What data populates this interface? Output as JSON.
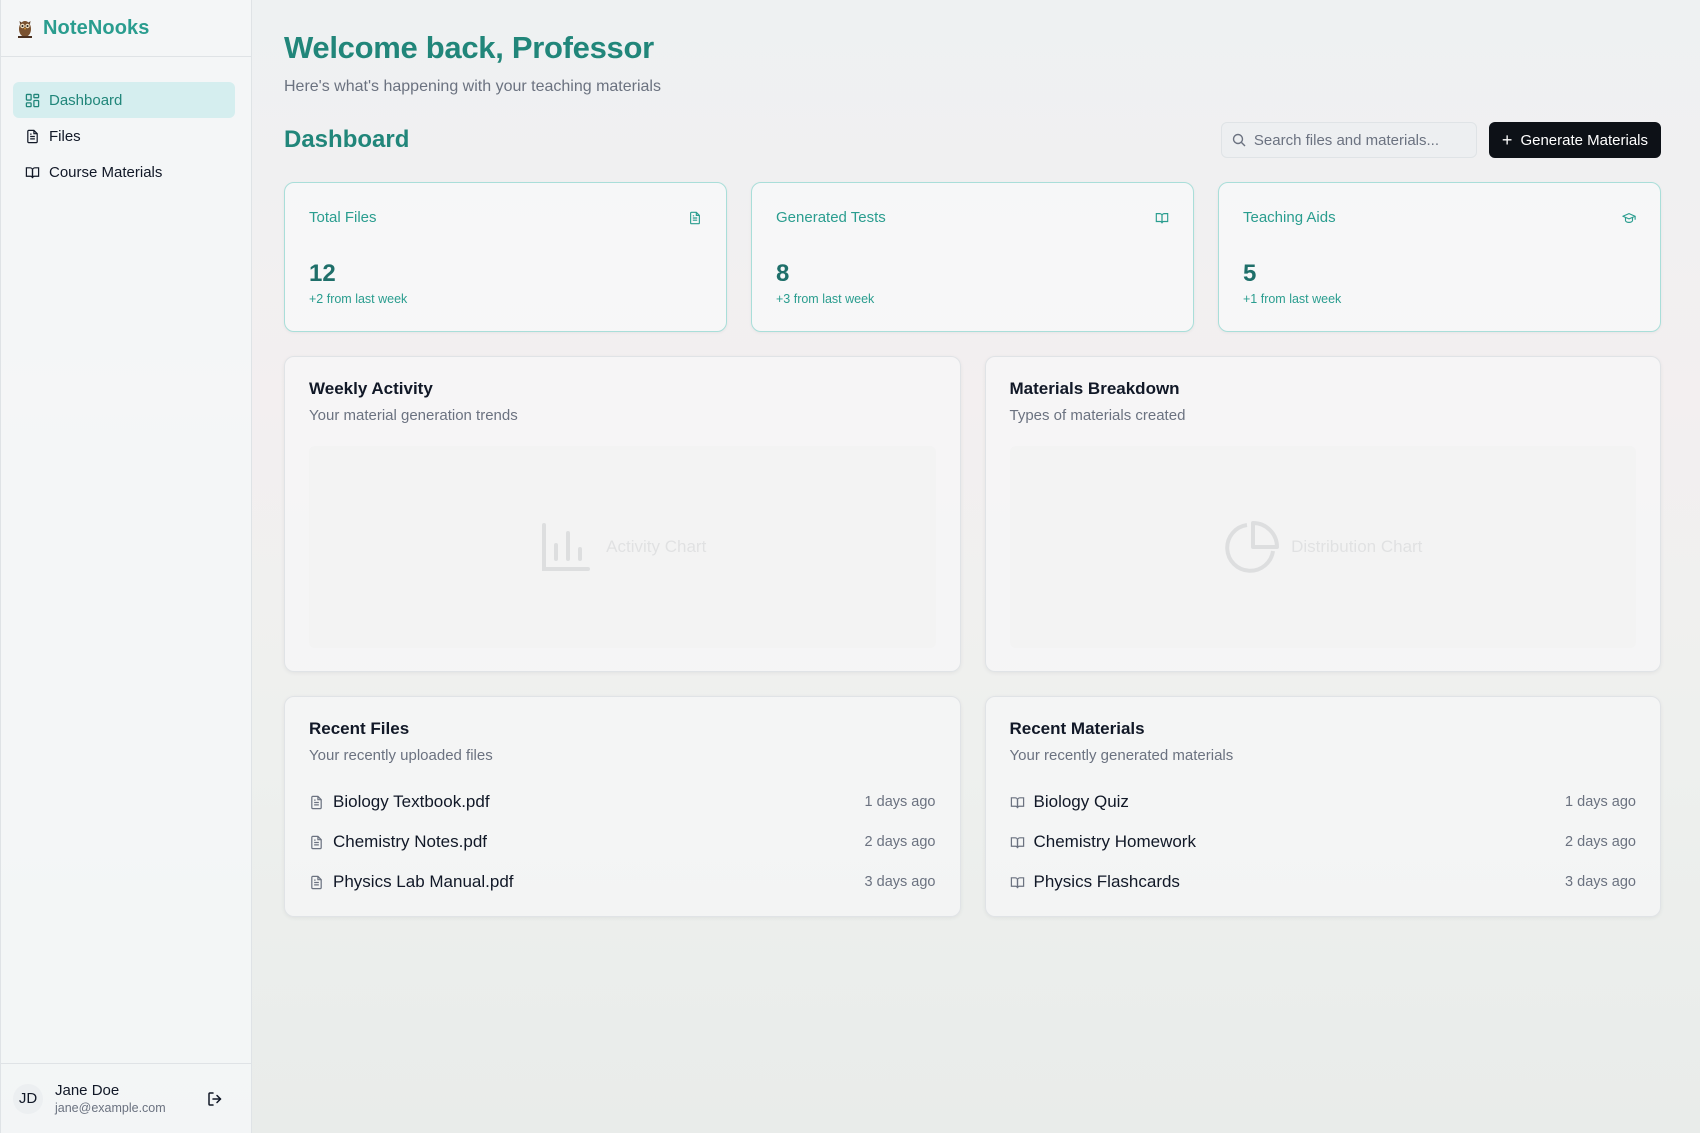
{
  "app": {
    "name": "NoteNooks"
  },
  "sidebar": {
    "items": [
      {
        "label": "Dashboard",
        "icon": "grid-icon",
        "active": true
      },
      {
        "label": "Files",
        "icon": "file-text-icon",
        "active": false
      },
      {
        "label": "Course Materials",
        "icon": "book-open-icon",
        "active": false
      }
    ],
    "user": {
      "initials": "JD",
      "name": "Jane Doe",
      "email": "jane@example.com"
    }
  },
  "header": {
    "welcome": "Welcome back, Professor",
    "subtitle": "Here's what's happening with your teaching materials"
  },
  "dashboard": {
    "title": "Dashboard",
    "search_placeholder": "Search files and materials...",
    "generate_label": "Generate Materials"
  },
  "stats": [
    {
      "label": "Total Files",
      "value": "12",
      "delta": "+2 from last week",
      "icon": "file-text-icon"
    },
    {
      "label": "Generated Tests",
      "value": "8",
      "delta": "+3 from last week",
      "icon": "book-open-icon"
    },
    {
      "label": "Teaching Aids",
      "value": "5",
      "delta": "+1 from last week",
      "icon": "graduation-cap-icon"
    }
  ],
  "charts": {
    "weekly": {
      "title": "Weekly Activity",
      "subtitle": "Your material generation trends",
      "placeholder": "Activity Chart"
    },
    "breakdown": {
      "title": "Materials Breakdown",
      "subtitle": "Types of materials created",
      "placeholder": "Distribution Chart"
    }
  },
  "recent_files": {
    "title": "Recent Files",
    "subtitle": "Your recently uploaded files",
    "items": [
      {
        "name": "Biology Textbook.pdf",
        "time": "1 days ago"
      },
      {
        "name": "Chemistry Notes.pdf",
        "time": "2 days ago"
      },
      {
        "name": "Physics Lab Manual.pdf",
        "time": "3 days ago"
      }
    ]
  },
  "recent_materials": {
    "title": "Recent Materials",
    "subtitle": "Your recently generated materials",
    "items": [
      {
        "name": "Biology Quiz",
        "time": "1 days ago"
      },
      {
        "name": "Chemistry Homework",
        "time": "2 days ago"
      },
      {
        "name": "Physics Flashcards",
        "time": "3 days ago"
      }
    ]
  },
  "colors": {
    "accent": "#2a9d8f",
    "accent_dark": "#21867a",
    "button": "#0d1117"
  }
}
